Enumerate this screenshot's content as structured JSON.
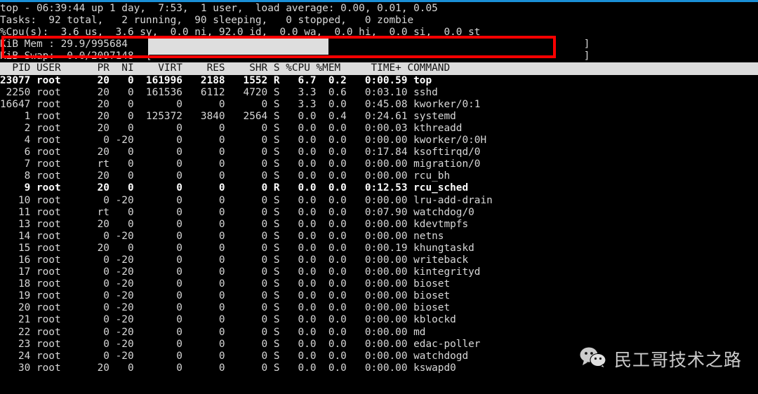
{
  "terminal": {
    "program": "top",
    "summary": {
      "uptime_line": "top - 06:39:44 up 1 day,  7:53,  1 user,  load average: 0.00, 0.01, 0.05",
      "tasks_line": "Tasks:  92 total,   2 running,  90 sleeping,   0 stopped,   0 zombie",
      "cpu_line": "%Cpu(s):  3.6 us,  3.6 sy,  0.0 ni, 92.0 id,  0.0 wa,  0.0 hi,  0.0 si,  0.0 st",
      "mem_line": "KiB Mem : 29.9/995684   [                                                                       ]",
      "swap_line": "KiB Swap:  0.0/2097148  [                                                                       ]"
    },
    "metrics": {
      "time": "06:39:44",
      "up": "1 day,  7:53",
      "users": "1 user",
      "load_average": [
        "0.00",
        "0.01",
        "0.05"
      ],
      "tasks_total": "92",
      "tasks_running": "2",
      "tasks_sleeping": "90",
      "tasks_stopped": "0",
      "tasks_zombie": "0",
      "cpu_us": "3.6",
      "cpu_sy": "3.6",
      "cpu_ni": "0.0",
      "cpu_id": "92.0",
      "cpu_wa": "0.0",
      "cpu_hi": "0.0",
      "cpu_si": "0.0",
      "cpu_st": "0.0",
      "mem_percent": "29.9",
      "mem_total": "995684",
      "swap_percent": "0.0",
      "swap_total": "2097148"
    },
    "table": {
      "header": "  PID USER      PR  NI    VIRT    RES    SHR S %CPU %MEM     TIME+ COMMAND",
      "columns": [
        "PID",
        "USER",
        "PR",
        "NI",
        "VIRT",
        "RES",
        "SHR",
        "S",
        "%CPU",
        "%MEM",
        "TIME+",
        "COMMAND"
      ],
      "rows": [
        {
          "text": "23077 root      20   0  161996   2188   1552 R   6.7  0.2   0:00.59 top",
          "bold": true,
          "pid": "23077",
          "user": "root",
          "pr": "20",
          "ni": "0",
          "virt": "161996",
          "res": "2188",
          "shr": "1552",
          "s": "R",
          "cpu": "6.7",
          "mem": "0.2",
          "time": "0:00.59",
          "command": "top"
        },
        {
          "text": " 2250 root      20   0  161536   6112   4720 S   3.3  0.6   0:03.10 sshd",
          "bold": false,
          "pid": "2250",
          "user": "root",
          "pr": "20",
          "ni": "0",
          "virt": "161536",
          "res": "6112",
          "shr": "4720",
          "s": "S",
          "cpu": "3.3",
          "mem": "0.6",
          "time": "0:03.10",
          "command": "sshd"
        },
        {
          "text": "16647 root      20   0       0      0      0 S   3.3  0.0   0:45.08 kworker/0:1",
          "bold": false,
          "pid": "16647",
          "user": "root",
          "pr": "20",
          "ni": "0",
          "virt": "0",
          "res": "0",
          "shr": "0",
          "s": "S",
          "cpu": "3.3",
          "mem": "0.0",
          "time": "0:45.08",
          "command": "kworker/0:1"
        },
        {
          "text": "    1 root      20   0  125372   3840   2564 S   0.0  0.4   0:24.61 systemd",
          "bold": false,
          "pid": "1",
          "user": "root",
          "pr": "20",
          "ni": "0",
          "virt": "125372",
          "res": "3840",
          "shr": "2564",
          "s": "S",
          "cpu": "0.0",
          "mem": "0.4",
          "time": "0:24.61",
          "command": "systemd"
        },
        {
          "text": "    2 root      20   0       0      0      0 S   0.0  0.0   0:00.03 kthreadd",
          "bold": false,
          "pid": "2",
          "user": "root",
          "pr": "20",
          "ni": "0",
          "virt": "0",
          "res": "0",
          "shr": "0",
          "s": "S",
          "cpu": "0.0",
          "mem": "0.0",
          "time": "0:00.03",
          "command": "kthreadd"
        },
        {
          "text": "    4 root       0 -20       0      0      0 S   0.0  0.0   0:00.00 kworker/0:0H",
          "bold": false,
          "pid": "4",
          "user": "root",
          "pr": "0",
          "ni": "-20",
          "virt": "0",
          "res": "0",
          "shr": "0",
          "s": "S",
          "cpu": "0.0",
          "mem": "0.0",
          "time": "0:00.00",
          "command": "kworker/0:0H"
        },
        {
          "text": "    6 root      20   0       0      0      0 S   0.0  0.0   0:17.84 ksoftirqd/0",
          "bold": false,
          "pid": "6",
          "user": "root",
          "pr": "20",
          "ni": "0",
          "virt": "0",
          "res": "0",
          "shr": "0",
          "s": "S",
          "cpu": "0.0",
          "mem": "0.0",
          "time": "0:17.84",
          "command": "ksoftirqd/0"
        },
        {
          "text": "    7 root      rt   0       0      0      0 S   0.0  0.0   0:00.00 migration/0",
          "bold": false,
          "pid": "7",
          "user": "root",
          "pr": "rt",
          "ni": "0",
          "virt": "0",
          "res": "0",
          "shr": "0",
          "s": "S",
          "cpu": "0.0",
          "mem": "0.0",
          "time": "0:00.00",
          "command": "migration/0"
        },
        {
          "text": "    8 root      20   0       0      0      0 S   0.0  0.0   0:00.00 rcu_bh",
          "bold": false,
          "pid": "8",
          "user": "root",
          "pr": "20",
          "ni": "0",
          "virt": "0",
          "res": "0",
          "shr": "0",
          "s": "S",
          "cpu": "0.0",
          "mem": "0.0",
          "time": "0:00.00",
          "command": "rcu_bh"
        },
        {
          "text": "    9 root      20   0       0      0      0 R   0.0  0.0   0:12.53 rcu_sched",
          "bold": true,
          "pid": "9",
          "user": "root",
          "pr": "20",
          "ni": "0",
          "virt": "0",
          "res": "0",
          "shr": "0",
          "s": "R",
          "cpu": "0.0",
          "mem": "0.0",
          "time": "0:12.53",
          "command": "rcu_sched"
        },
        {
          "text": "   10 root       0 -20       0      0      0 S   0.0  0.0   0:00.00 lru-add-drain",
          "bold": false,
          "pid": "10",
          "user": "root",
          "pr": "0",
          "ni": "-20",
          "virt": "0",
          "res": "0",
          "shr": "0",
          "s": "S",
          "cpu": "0.0",
          "mem": "0.0",
          "time": "0:00.00",
          "command": "lru-add-drain"
        },
        {
          "text": "   11 root      rt   0       0      0      0 S   0.0  0.0   0:07.90 watchdog/0",
          "bold": false,
          "pid": "11",
          "user": "root",
          "pr": "rt",
          "ni": "0",
          "virt": "0",
          "res": "0",
          "shr": "0",
          "s": "S",
          "cpu": "0.0",
          "mem": "0.0",
          "time": "0:07.90",
          "command": "watchdog/0"
        },
        {
          "text": "   13 root      20   0       0      0      0 S   0.0  0.0   0:00.00 kdevtmpfs",
          "bold": false,
          "pid": "13",
          "user": "root",
          "pr": "20",
          "ni": "0",
          "virt": "0",
          "res": "0",
          "shr": "0",
          "s": "S",
          "cpu": "0.0",
          "mem": "0.0",
          "time": "0:00.00",
          "command": "kdevtmpfs"
        },
        {
          "text": "   14 root       0 -20       0      0      0 S   0.0  0.0   0:00.00 netns",
          "bold": false,
          "pid": "14",
          "user": "root",
          "pr": "0",
          "ni": "-20",
          "virt": "0",
          "res": "0",
          "shr": "0",
          "s": "S",
          "cpu": "0.0",
          "mem": "0.0",
          "time": "0:00.00",
          "command": "netns"
        },
        {
          "text": "   15 root      20   0       0      0      0 S   0.0  0.0   0:00.19 khungtaskd",
          "bold": false,
          "pid": "15",
          "user": "root",
          "pr": "20",
          "ni": "0",
          "virt": "0",
          "res": "0",
          "shr": "0",
          "s": "S",
          "cpu": "0.0",
          "mem": "0.0",
          "time": "0:00.19",
          "command": "khungtaskd"
        },
        {
          "text": "   16 root       0 -20       0      0      0 S   0.0  0.0   0:00.00 writeback",
          "bold": false,
          "pid": "16",
          "user": "root",
          "pr": "0",
          "ni": "-20",
          "virt": "0",
          "res": "0",
          "shr": "0",
          "s": "S",
          "cpu": "0.0",
          "mem": "0.0",
          "time": "0:00.00",
          "command": "writeback"
        },
        {
          "text": "   17 root       0 -20       0      0      0 S   0.0  0.0   0:00.00 kintegrityd",
          "bold": false,
          "pid": "17",
          "user": "root",
          "pr": "0",
          "ni": "-20",
          "virt": "0",
          "res": "0",
          "shr": "0",
          "s": "S",
          "cpu": "0.0",
          "mem": "0.0",
          "time": "0:00.00",
          "command": "kintegrityd"
        },
        {
          "text": "   18 root       0 -20       0      0      0 S   0.0  0.0   0:00.00 bioset",
          "bold": false,
          "pid": "18",
          "user": "root",
          "pr": "0",
          "ni": "-20",
          "virt": "0",
          "res": "0",
          "shr": "0",
          "s": "S",
          "cpu": "0.0",
          "mem": "0.0",
          "time": "0:00.00",
          "command": "bioset"
        },
        {
          "text": "   19 root       0 -20       0      0      0 S   0.0  0.0   0:00.00 bioset",
          "bold": false,
          "pid": "19",
          "user": "root",
          "pr": "0",
          "ni": "-20",
          "virt": "0",
          "res": "0",
          "shr": "0",
          "s": "S",
          "cpu": "0.0",
          "mem": "0.0",
          "time": "0:00.00",
          "command": "bioset"
        },
        {
          "text": "   20 root       0 -20       0      0      0 S   0.0  0.0   0:00.00 bioset",
          "bold": false,
          "pid": "20",
          "user": "root",
          "pr": "0",
          "ni": "-20",
          "virt": "0",
          "res": "0",
          "shr": "0",
          "s": "S",
          "cpu": "0.0",
          "mem": "0.0",
          "time": "0:00.00",
          "command": "bioset"
        },
        {
          "text": "   21 root       0 -20       0      0      0 S   0.0  0.0   0:00.00 kblockd",
          "bold": false,
          "pid": "21",
          "user": "root",
          "pr": "0",
          "ni": "-20",
          "virt": "0",
          "res": "0",
          "shr": "0",
          "s": "S",
          "cpu": "0.0",
          "mem": "0.0",
          "time": "0:00.00",
          "command": "kblockd"
        },
        {
          "text": "   22 root       0 -20       0      0      0 S   0.0  0.0   0:00.00 md",
          "bold": false,
          "pid": "22",
          "user": "root",
          "pr": "0",
          "ni": "-20",
          "virt": "0",
          "res": "0",
          "shr": "0",
          "s": "S",
          "cpu": "0.0",
          "mem": "0.0",
          "time": "0:00.00",
          "command": "md"
        },
        {
          "text": "   23 root       0 -20       0      0      0 S   0.0  0.0   0:00.00 edac-poller",
          "bold": false,
          "pid": "23",
          "user": "root",
          "pr": "0",
          "ni": "-20",
          "virt": "0",
          "res": "0",
          "shr": "0",
          "s": "S",
          "cpu": "0.0",
          "mem": "0.0",
          "time": "0:00.00",
          "command": "edac-poller"
        },
        {
          "text": "   24 root       0 -20       0      0      0 S   0.0  0.0   0:00.00 watchdogd",
          "bold": false,
          "pid": "24",
          "user": "root",
          "pr": "0",
          "ni": "-20",
          "virt": "0",
          "res": "0",
          "shr": "0",
          "s": "S",
          "cpu": "0.0",
          "mem": "0.0",
          "time": "0:00.00",
          "command": "watchdogd"
        },
        {
          "text": "   30 root      20   0       0      0      0 S   0.0  0.0   0:00.00 kswapd0",
          "bold": false,
          "pid": "30",
          "user": "root",
          "pr": "20",
          "ni": "0",
          "virt": "0",
          "res": "0",
          "shr": "0",
          "s": "S",
          "cpu": "0.0",
          "mem": "0.0",
          "time": "0:00.00",
          "command": "kswapd0"
        }
      ]
    }
  },
  "annotation": {
    "shape": "rectangle",
    "color": "#fe0000",
    "target": "KiB Mem line"
  },
  "watermark": {
    "icon": "wechat-icon",
    "text": "民工哥技术之路"
  },
  "colors": {
    "background": "#000000",
    "foreground": "#d8d8d8",
    "accent_top_rule": "#1a8fd6",
    "header_bar_bg": "#dcdcdc",
    "header_bar_fg": "#101010",
    "gauge_fill": "#dedede",
    "annotation_red": "#fe0000"
  }
}
